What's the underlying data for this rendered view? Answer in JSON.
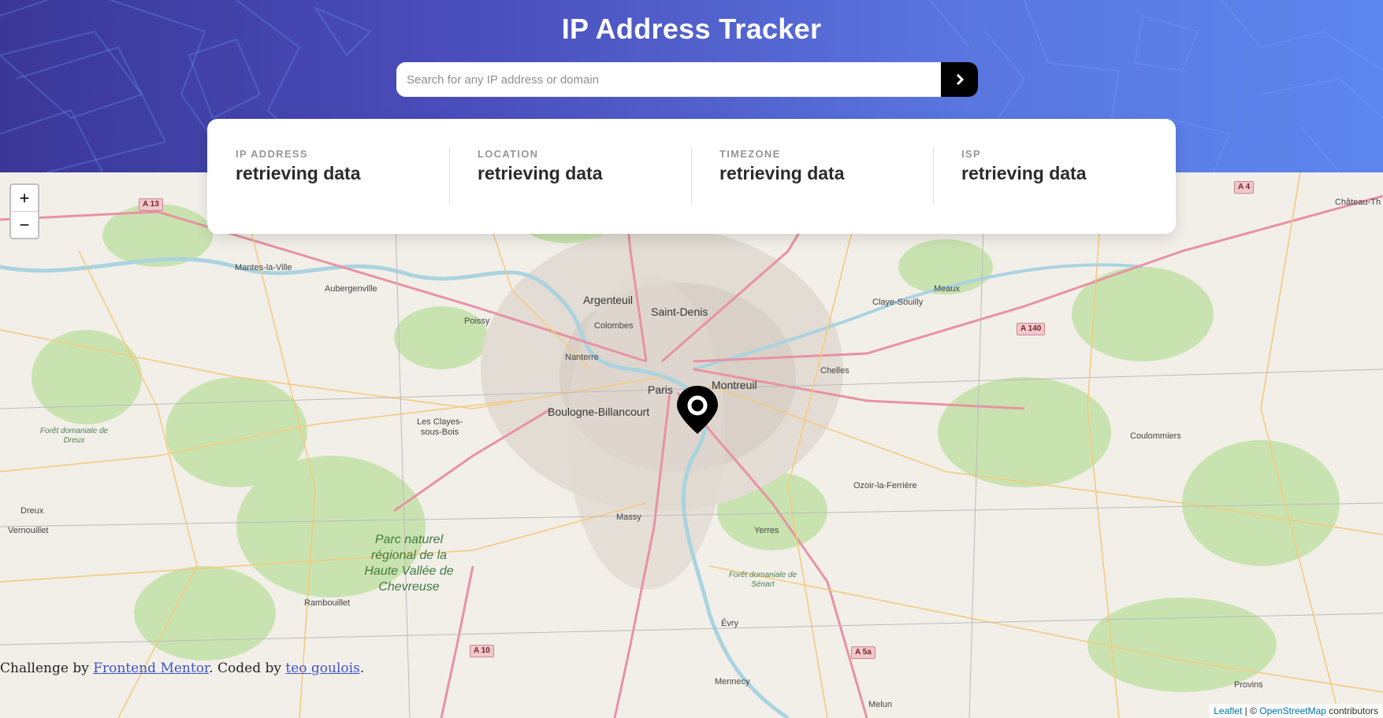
{
  "header": {
    "title": "IP Address Tracker",
    "search_placeholder": "Search for any IP address or domain",
    "search_value": "",
    "submit_icon": "chevron-right-icon"
  },
  "info": [
    {
      "label": "IP ADDRESS",
      "value": "retrieving data"
    },
    {
      "label": "LOCATION",
      "value": "retrieving data"
    },
    {
      "label": "TIMEZONE",
      "value": "retrieving data"
    },
    {
      "label": "ISP",
      "value": "retrieving data"
    }
  ],
  "map": {
    "zoom_in": "+",
    "zoom_out": "−",
    "marker_icon": "location-pin-icon",
    "labels": {
      "paris": "Paris",
      "boulogne": "Boulogne-Billancourt",
      "argenteuil": "Argenteuil",
      "saint_denis": "Saint-Denis",
      "montreuil": "Montreuil",
      "meaux": "Meaux",
      "coulommiers": "Coulommiers",
      "mantes": "Mantes-la-Ville",
      "dreux": "Dreux",
      "vernouillet": "Vernouillet",
      "rambouillet": "Rambouillet",
      "aubergenville": "Aubergenville",
      "poissy": "Poissy",
      "nanterre": "Nanterre",
      "colombes": "Colombes",
      "chelles": "Chelles",
      "massy": "Massy",
      "evry": "Évry",
      "melun": "Melun",
      "provins": "Provins",
      "yerres": "Yerres",
      "les_clayes": "Les Clayes-sous-Bois",
      "chateau_thierry": "Château-Th",
      "claye_souilly": "Claye-Souilly",
      "ozoir": "Ozoir-la-Ferrière",
      "mennecy": "Mennecy",
      "park": "Parc naturel régional de la Haute Vallée de Chevreuse",
      "forest_dreux": "Forêt domaniale de Dreux",
      "forest_senart": "Forêt domaniale de Sénart"
    },
    "shields": {
      "a13": "A 13",
      "a4": "A 4",
      "a140": "A 140",
      "a10": "A 10",
      "a5a": "A 5a"
    }
  },
  "footer": {
    "challenge_prefix": "Challenge by ",
    "frontend_mentor": "Frontend Mentor",
    "coded_by": ". Coded by ",
    "author": "teo goulois",
    "suffix": ".",
    "leaflet": "Leaflet",
    "osm_prefix": " | © ",
    "osm": "OpenStreetMap",
    "osm_suffix": " contributors"
  },
  "colors": {
    "header_gradient_start": "#3a3797",
    "header_gradient_end": "#5c86ee",
    "card_bg": "#ffffff",
    "button_bg": "#000000"
  }
}
